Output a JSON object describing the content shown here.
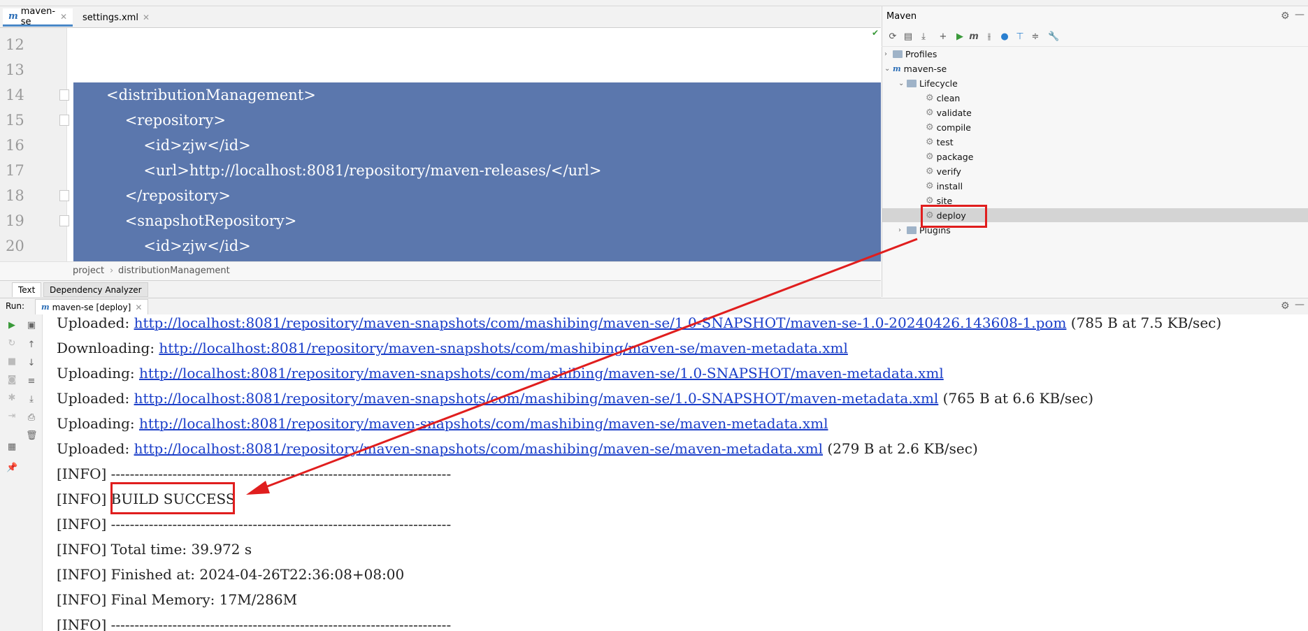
{
  "tabs": [
    {
      "label": "maven-se",
      "active": true
    },
    {
      "label": "settings.xml",
      "active": false
    }
  ],
  "editor": {
    "line_numbers": [
      "12",
      "13",
      "14",
      "15",
      "16",
      "17",
      "18",
      "19",
      "20"
    ],
    "lines": [
      "",
      "",
      "<distributionManagement>",
      "    <repository>",
      "        <id>zjw</id>",
      "        <url>http://localhost:8081/repository/maven-releases/</url>",
      "    </repository>",
      "    <snapshotRepository>",
      "        <id>zjw</id>"
    ],
    "breadcrumb": [
      "project",
      "distributionManagement"
    ],
    "bottom_tabs": [
      "Text",
      "Dependency Analyzer"
    ]
  },
  "maven": {
    "title": "Maven",
    "tree": {
      "profiles": "Profiles",
      "project": "maven-se",
      "lifecycle": "Lifecycle",
      "phases": [
        "clean",
        "validate",
        "compile",
        "test",
        "package",
        "verify",
        "install",
        "site",
        "deploy"
      ],
      "plugins": "Plugins"
    },
    "selected_phase": "deploy"
  },
  "run": {
    "label": "Run:",
    "tab": "maven-se [deploy]",
    "lines": [
      {
        "prefix": "Uploaded: ",
        "link": "http://localhost:8081/repository/maven-snapshots/com/mashibing/maven-se/1.0-SNAPSHOT/maven-se-1.0-20240426.143608-1.pom",
        "suffix": " (785 B at 7.5 KB/sec)"
      },
      {
        "prefix": "Downloading: ",
        "link": "http://localhost:8081/repository/maven-snapshots/com/mashibing/maven-se/maven-metadata.xml",
        "suffix": ""
      },
      {
        "prefix": "Uploading: ",
        "link": "http://localhost:8081/repository/maven-snapshots/com/mashibing/maven-se/1.0-SNAPSHOT/maven-metadata.xml",
        "suffix": ""
      },
      {
        "prefix": "Uploaded: ",
        "link": "http://localhost:8081/repository/maven-snapshots/com/mashibing/maven-se/1.0-SNAPSHOT/maven-metadata.xml",
        "suffix": " (765 B at 6.6 KB/sec)"
      },
      {
        "prefix": "Uploading: ",
        "link": "http://localhost:8081/repository/maven-snapshots/com/mashibing/maven-se/maven-metadata.xml",
        "suffix": ""
      },
      {
        "prefix": "Uploaded: ",
        "link": "http://localhost:8081/repository/maven-snapshots/com/mashibing/maven-se/maven-metadata.xml",
        "suffix": " (279 B at 2.6 KB/sec)"
      },
      {
        "prefix": "[INFO] ------------------------------------------------------------------------",
        "link": "",
        "suffix": ""
      },
      {
        "prefix": "[INFO] BUILD SUCCESS",
        "link": "",
        "suffix": ""
      },
      {
        "prefix": "[INFO] ------------------------------------------------------------------------",
        "link": "",
        "suffix": ""
      },
      {
        "prefix": "[INFO] Total time: 39.972 s",
        "link": "",
        "suffix": ""
      },
      {
        "prefix": "[INFO] Finished at: 2024-04-26T22:36:08+08:00",
        "link": "",
        "suffix": ""
      },
      {
        "prefix": "[INFO] Final Memory: 17M/286M",
        "link": "",
        "suffix": ""
      },
      {
        "prefix": "[INFO] ------------------------------------------------------------------------",
        "link": "",
        "suffix": ""
      }
    ]
  },
  "colors": {
    "selection": "#5b77ad",
    "link": "#1a3ec9",
    "annotation": "#e01e1e"
  }
}
